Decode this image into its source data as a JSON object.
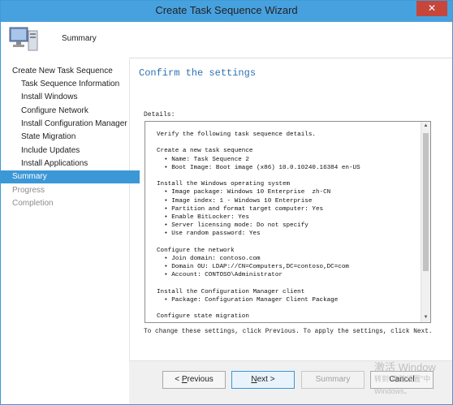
{
  "window": {
    "title": "Create Task Sequence Wizard",
    "close_glyph": "✕"
  },
  "header": {
    "title": "Summary",
    "icon": "computer-icon"
  },
  "sidebar": {
    "items": [
      {
        "label": "Create New Task Sequence",
        "level": 1,
        "state": "normal"
      },
      {
        "label": "Task Sequence Information",
        "level": 2,
        "state": "normal"
      },
      {
        "label": "Install Windows",
        "level": 2,
        "state": "normal"
      },
      {
        "label": "Configure Network",
        "level": 2,
        "state": "normal"
      },
      {
        "label": "Install Configuration Manager",
        "level": 2,
        "state": "normal"
      },
      {
        "label": "State Migration",
        "level": 2,
        "state": "normal"
      },
      {
        "label": "Include Updates",
        "level": 2,
        "state": "normal"
      },
      {
        "label": "Install Applications",
        "level": 2,
        "state": "normal"
      },
      {
        "label": "Summary",
        "level": 1,
        "state": "selected"
      },
      {
        "label": "Progress",
        "level": 1,
        "state": "disabled"
      },
      {
        "label": "Completion",
        "level": 1,
        "state": "disabled"
      }
    ]
  },
  "main": {
    "title": "Confirm the settings",
    "details_label": "Details:",
    "details_lines": [
      "Verify the following task sequence details.",
      "",
      "Create a new task sequence",
      "  • Name: Task Sequence 2",
      "  • Boot Image: Boot image (x86) 10.0.10240.16384 en-US",
      "",
      "Install the Windows operating system",
      "  • Image package: Windows 10 Enterprise  zh-CN",
      "  • Image index: 1 - Windows 10 Enterprise",
      "  • Partition and format target computer: Yes",
      "  • Enable BitLocker: Yes",
      "  • Server licensing mode: Do not specify",
      "  • Use random password: Yes",
      "",
      "Configure the network",
      "  • Join domain: contoso.com",
      "  • Domain OU: LDAP://CN=Computers,DC=contoso,DC=com",
      "  • Account: CONTOSO\\Administrator",
      "",
      "Install the Configuration Manager client",
      "  • Package: Configuration Manager Client Package",
      "",
      "Configure state migration"
    ],
    "instructions": "To change these settings, click Previous. To apply the settings, click Next."
  },
  "buttons": {
    "previous_prefix": "< ",
    "previous_accel": "P",
    "previous_rest": "revious",
    "next_accel": "N",
    "next_rest": "ext >",
    "summary": "Summary",
    "cancel": "Cancel"
  },
  "watermark": {
    "line1": "激活 Window",
    "line2": "转到\"电脑设置\"中",
    "line3": "Windows。"
  },
  "colors": {
    "titlebar": "#48a1df",
    "selected": "#3c97d6",
    "heading": "#2e6fb2"
  }
}
